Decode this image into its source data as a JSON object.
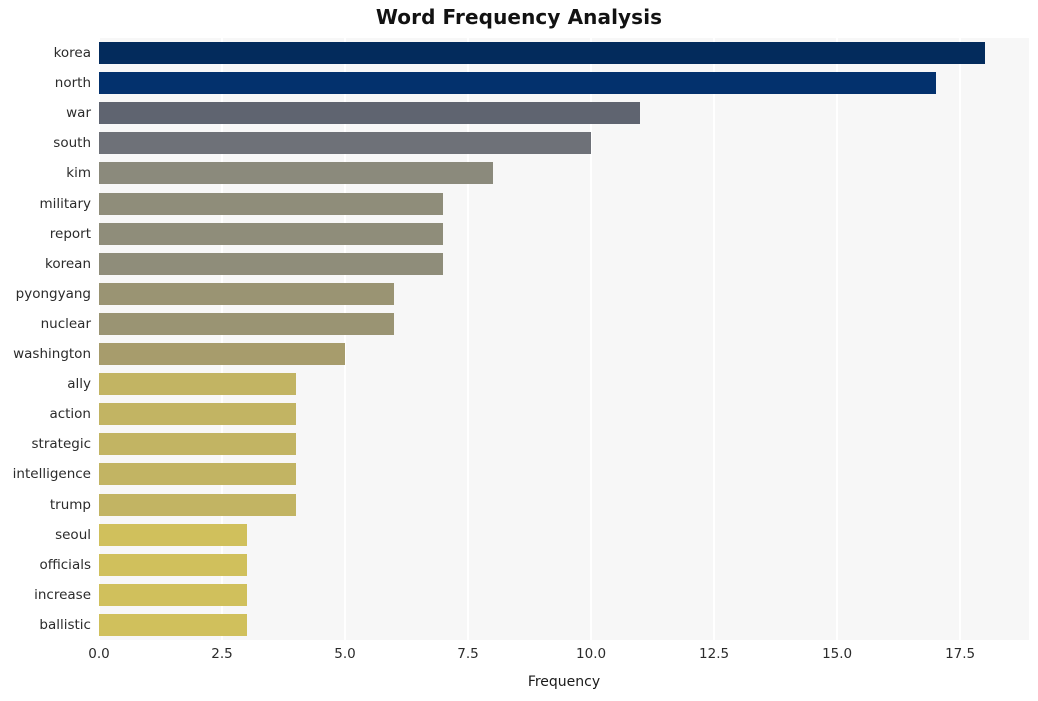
{
  "chart_data": {
    "type": "bar",
    "orientation": "horizontal",
    "title": "Word Frequency Analysis",
    "xlabel": "Frequency",
    "ylabel": "",
    "categories": [
      "korea",
      "north",
      "war",
      "south",
      "kim",
      "military",
      "report",
      "korean",
      "pyongyang",
      "nuclear",
      "washington",
      "ally",
      "action",
      "strategic",
      "intelligence",
      "trump",
      "seoul",
      "officials",
      "increase",
      "ballistic"
    ],
    "values": [
      18,
      17,
      11,
      10,
      8,
      7,
      7,
      7,
      6,
      6,
      5,
      4,
      4,
      4,
      4,
      4,
      3,
      3,
      3,
      3
    ],
    "xlim": [
      0,
      18.9
    ],
    "xticks": [
      "0.0",
      "2.5",
      "5.0",
      "7.5",
      "10.0",
      "12.5",
      "15.0",
      "17.5"
    ],
    "xtick_values": [
      0,
      2.5,
      5,
      7.5,
      10,
      12.5,
      15,
      17.5
    ],
    "grid": "vertical-white",
    "plot_background": "#f7f7f7",
    "figure_background": "#ffffff",
    "legend": "none",
    "colormap": "cividis",
    "bar_colors": [
      "#032b5c",
      "#03316d",
      "#5f6470",
      "#6e7178",
      "#8b8a7c",
      "#8f8d7a",
      "#8f8d7a",
      "#8f8d7a",
      "#9a9473",
      "#9a9473",
      "#a79c6c",
      "#c2b463",
      "#c2b463",
      "#c2b463",
      "#c2b463",
      "#c2b463",
      "#d0c05c",
      "#d0c05c",
      "#d0c05c",
      "#d0c05c"
    ]
  }
}
